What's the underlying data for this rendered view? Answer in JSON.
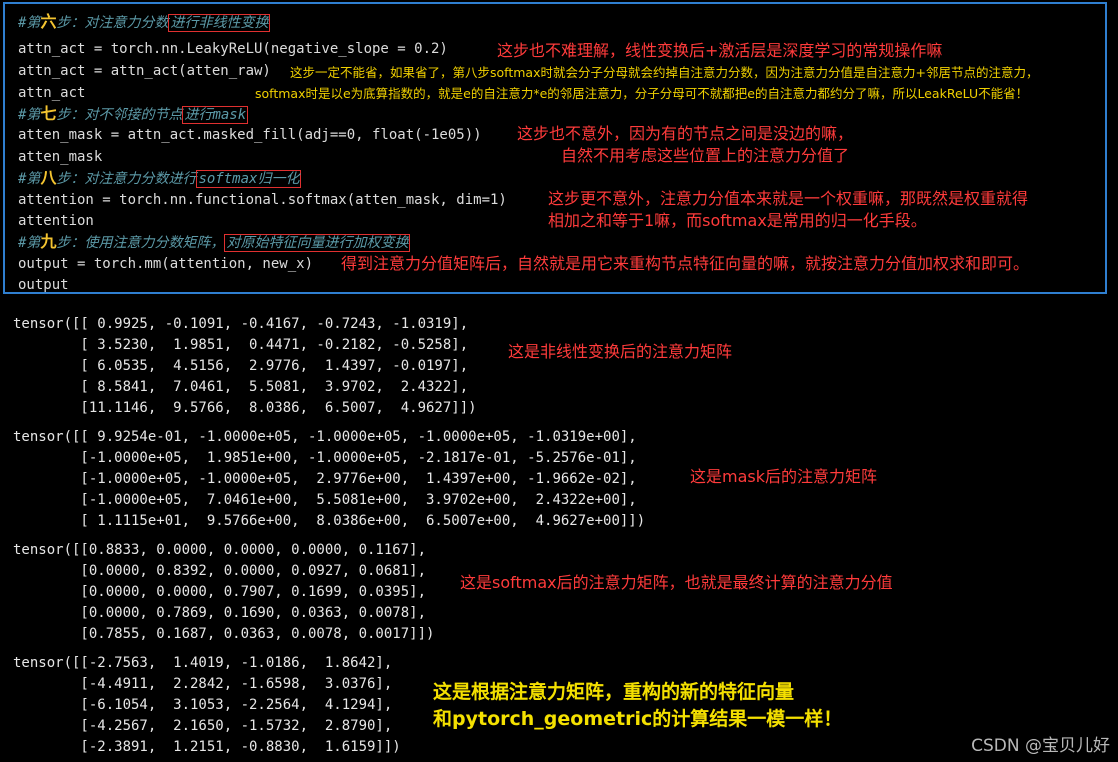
{
  "code": {
    "step6_prefix": "#第",
    "step6_num": "六",
    "step6_mid": "步：对注意力分数",
    "step6_box": "进行非线性变换",
    "l2": "attn_act = torch.nn.LeakyReLU(negative_slope = 0.2)",
    "l3": "attn_act = attn_act(atten_raw)",
    "l4": "attn_act",
    "step7_prefix": "#第",
    "step7_num": "七",
    "step7_mid": "步：对不邻接的节点",
    "step7_box": "进行mask",
    "l6": "atten_mask = attn_act.masked_fill(adj==0, float(-1e05))",
    "l7": "atten_mask",
    "step8_prefix": "#第",
    "step8_num": "八",
    "step8_mid": "步：对注意力分数进行",
    "step8_box": "softmax归一化",
    "l9": "attention = torch.nn.functional.softmax(atten_mask, dim=1)",
    "l10": "attention",
    "step9_prefix": "#第",
    "step9_num": "九",
    "step9_mid": "步：使用注意力分数矩阵，",
    "step9_box": "对原始特征向量进行加权变换",
    "l12": "output = torch.mm(attention, new_x)",
    "l13": "output"
  },
  "annotations": {
    "a1": "这步也不难理解，线性变换后+激活层是深度学习的常规操作嘛",
    "a2_line1": "这步一定不能省，如果省了，第八步softmax时就会分子分母就会约掉自注意力分数，因为注意力分值是自注意力+邻居节点的注意力，",
    "a2_line2": "softmax时是以e为底算指数的，就是e的自注意力*e的邻居注意力，分子分母可不就都把e的自注意力都约分了嘛，所以LeakReLU不能省！",
    "a3_line1": "这步也不意外，因为有的节点之间是没边的嘛，",
    "a3_line2": "自然不用考虑这些位置上的注意力分值了",
    "a4_line1": "这步更不意外，注意力分值本来就是一个权重嘛，那既然是权重就得",
    "a4_line2": "相加之和等于1嘛，而softmax是常用的归一化手段。",
    "a5": "得到注意力分值矩阵后，自然就是用它来重构节点特征向量的嘛，就按注意力分值加权求和即可。",
    "o1": "这是非线性变换后的注意力矩阵",
    "o2": "这是mask后的注意力矩阵",
    "o3": "这是softmax后的注意力矩阵，也就是最终计算的注意力分值",
    "o4_line1": "这是根据注意力矩阵，重构的新的特征向量",
    "o4_line2": "和pytorch_geometric的计算结果一模一样！"
  },
  "outputs": {
    "t1": "tensor([[ 0.9925, -0.1091, -0.4167, -0.7243, -1.0319],\n        [ 3.5230,  1.9851,  0.4471, -0.2182, -0.5258],\n        [ 6.0535,  4.5156,  2.9776,  1.4397, -0.0197],\n        [ 8.5841,  7.0461,  5.5081,  3.9702,  2.4322],\n        [11.1146,  9.5766,  8.0386,  6.5007,  4.9627]])",
    "t2": "tensor([[ 9.9254e-01, -1.0000e+05, -1.0000e+05, -1.0000e+05, -1.0319e+00],\n        [-1.0000e+05,  1.9851e+00, -1.0000e+05, -2.1817e-01, -5.2576e-01],\n        [-1.0000e+05, -1.0000e+05,  2.9776e+00,  1.4397e+00, -1.9662e-02],\n        [-1.0000e+05,  7.0461e+00,  5.5081e+00,  3.9702e+00,  2.4322e+00],\n        [ 1.1115e+01,  9.5766e+00,  8.0386e+00,  6.5007e+00,  4.9627e+00]])",
    "t3": "tensor([[0.8833, 0.0000, 0.0000, 0.0000, 0.1167],\n        [0.0000, 0.8392, 0.0000, 0.0927, 0.0681],\n        [0.0000, 0.0000, 0.7907, 0.1699, 0.0395],\n        [0.0000, 0.7869, 0.1690, 0.0363, 0.0078],\n        [0.7855, 0.1687, 0.0363, 0.0078, 0.0017]])",
    "t4": "tensor([[-2.7563,  1.4019, -1.0186,  1.8642],\n        [-4.4911,  2.2842, -1.6598,  3.0376],\n        [-6.1054,  3.1053, -2.2564,  4.1294],\n        [-4.2567,  2.1650, -1.5732,  2.8790],\n        [-2.3891,  1.2151, -0.8830,  1.6159]])"
  },
  "watermark": "CSDN @宝贝儿好"
}
